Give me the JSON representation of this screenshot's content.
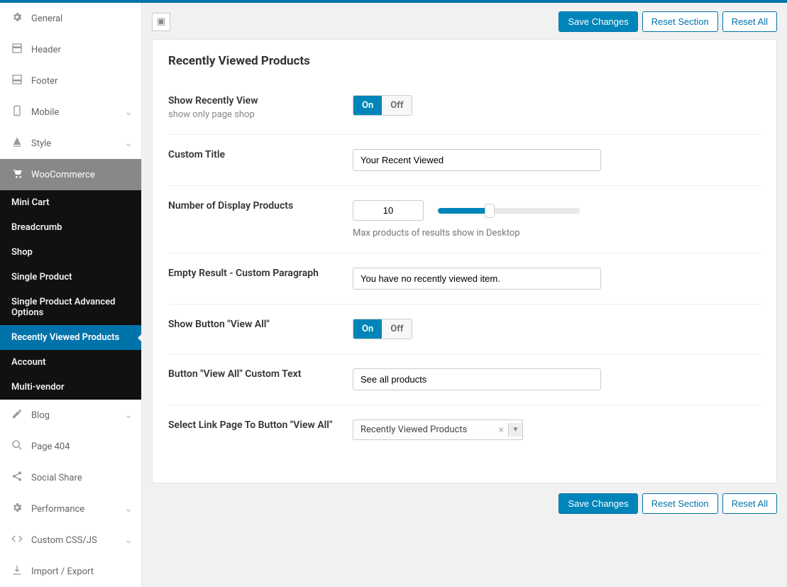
{
  "buttons": {
    "save": "Save Changes",
    "reset_section": "Reset Section",
    "reset_all": "Reset All"
  },
  "panel_title": "Recently Viewed Products",
  "sidebar": {
    "items": [
      "General",
      "Header",
      "Footer",
      "Mobile",
      "Style",
      "WooCommerce",
      "Blog",
      "Page 404",
      "Social Share",
      "Performance",
      "Custom CSS/JS",
      "Import / Export"
    ],
    "sub": [
      "Mini Cart",
      "Breadcrumb",
      "Shop",
      "Single Product",
      "Single Product Advanced Options",
      "Recently Viewed Products",
      "Account",
      "Multi-vendor"
    ]
  },
  "fields": {
    "show_recent": {
      "label": "Show Recently View",
      "desc": "show only page shop",
      "on": "On",
      "off": "Off"
    },
    "custom_title": {
      "label": "Custom Title",
      "value": "Your Recent Viewed"
    },
    "num_display": {
      "label": "Number of Display Products",
      "value": "10",
      "hint": "Max products of results show in Desktop"
    },
    "empty_result": {
      "label": "Empty Result - Custom Paragraph",
      "value": "You have no recently viewed item."
    },
    "show_viewall_btn": {
      "label": "Show Button \"View All\"",
      "on": "On",
      "off": "Off"
    },
    "viewall_text": {
      "label": "Button \"View All\" Custom Text",
      "value": "See all products"
    },
    "viewall_link": {
      "label": "Select Link Page To Button \"View All\"",
      "value": "Recently Viewed Products"
    }
  }
}
